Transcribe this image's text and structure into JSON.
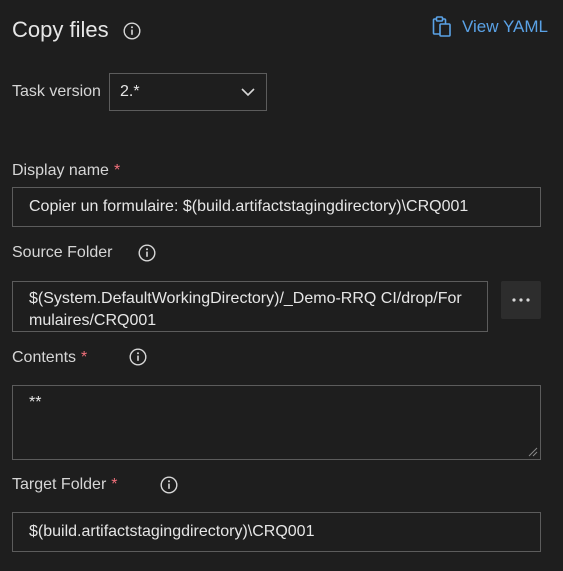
{
  "header": {
    "title": "Copy files",
    "view_yaml_label": "View YAML"
  },
  "task_version": {
    "label": "Task version",
    "value": "2.*"
  },
  "display_name": {
    "label": "Display name",
    "required": "*",
    "value": "Copier un formulaire: $(build.artifactstagingdirectory)\\CRQ001"
  },
  "source_folder": {
    "label": "Source Folder",
    "value": "$(System.DefaultWorkingDirectory)/_Demo-RRQ CI/drop/Formulaires/CRQ001"
  },
  "contents": {
    "label": "Contents",
    "required": "*",
    "value": "**"
  },
  "target_folder": {
    "label": "Target Folder",
    "required": "*",
    "value": "$(build.artifactstagingdirectory)\\CRQ001"
  },
  "colors": {
    "background": "#1e1e1e",
    "link": "#5aa2e6",
    "required": "#f1707b",
    "border": "#5c5c5c"
  },
  "icons": [
    "info-icon",
    "clipboard-icon",
    "chevron-down-icon",
    "ellipsis-icon",
    "resize-grip-icon"
  ]
}
